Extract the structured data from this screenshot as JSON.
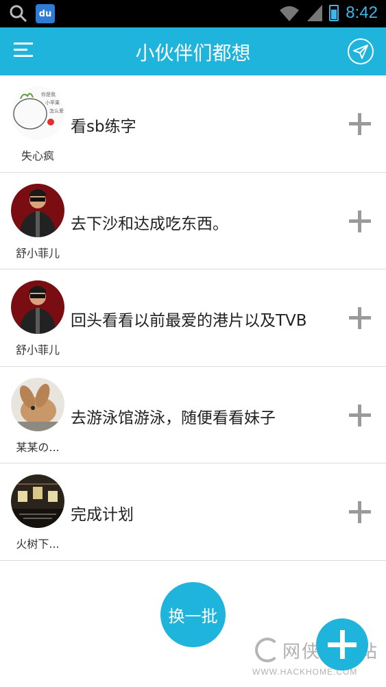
{
  "status_bar": {
    "time": "8:42",
    "baidu_label": "du",
    "icons": [
      "search-icon",
      "baidu-icon",
      "wifi-icon",
      "signal-icon",
      "battery-icon"
    ]
  },
  "app_bar": {
    "title": "小伙伴们都想",
    "left_icon": "menu-icon",
    "right_icon": "paper-plane-icon",
    "color": "#1fb4dc"
  },
  "wishes": [
    {
      "user": "失心疯",
      "text": "看sb练字",
      "avatar": "doodle-avatar"
    },
    {
      "user": "舒小菲儿",
      "text": "去下沙和达成吃东西。",
      "avatar": "singer-avatar"
    },
    {
      "user": "舒小菲儿",
      "text": "回头看看以前最爱的港片以及TVB",
      "avatar": "singer-avatar"
    },
    {
      "user": "某某の...",
      "text": "去游泳馆游泳，随便看看妹子",
      "avatar": "rabbit-avatar"
    },
    {
      "user": "火树下...",
      "text": "完成计划",
      "avatar": "dark-room-avatar"
    }
  ],
  "refresh_label": "换一批",
  "watermark": {
    "main": "网侠手机站",
    "sub": "WWW.HACKHOME.COM"
  }
}
